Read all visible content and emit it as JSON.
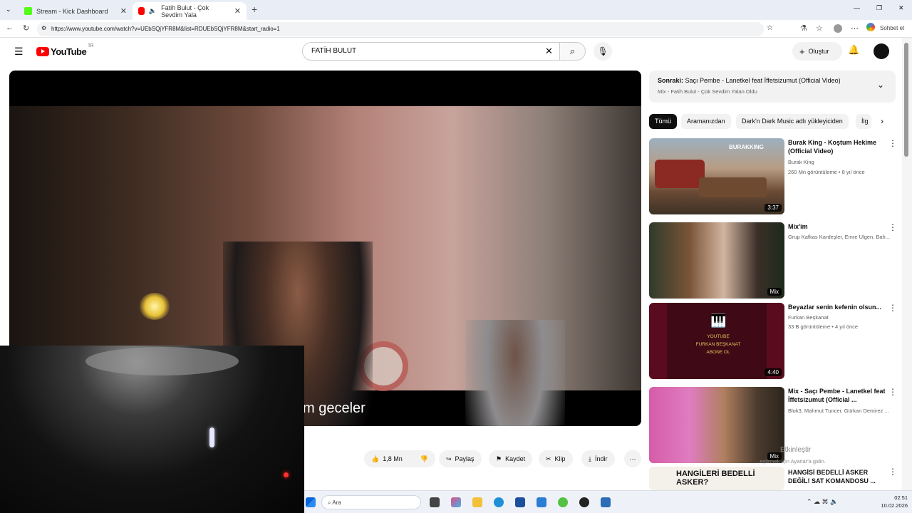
{
  "browser": {
    "tabs": [
      {
        "label": "Stream - Kick Dashboard",
        "active": false
      },
      {
        "label": "Fatih Bulut - Çok Sevdim Yala",
        "active": true
      }
    ],
    "new_tab": "+",
    "url": "https://www.youtube.com/watch?v=UEbSQjYFR8M&list=RDUEbSQjYFR8M&start_radio=1",
    "sohbet": "Sohbet et"
  },
  "youtube": {
    "logo": "YouTube",
    "region": "TR",
    "search_value": "FATİH BULUT",
    "create_label": "Oluştur"
  },
  "player": {
    "subtitle": "m geceler"
  },
  "actions": {
    "likes": "1,8 Mn",
    "share": "Paylaş",
    "save": "Kaydet",
    "clip": "Klip",
    "download": "İndir"
  },
  "mix": {
    "next_prefix": "Sonraki:",
    "next_title": "Saçı Pembe - Lanetkel feat İffetsizumut (Official Video)",
    "subtitle": "Mix - Fatih Bulut - Çok Sevdim Yalan Oldu"
  },
  "chips": [
    "Tümü",
    "Aramanızdan",
    "Dark'n Dark Music adlı yükleyiciden",
    "İlg"
  ],
  "recommendations": [
    {
      "title": "Burak King - Koştum Hekime (Official Video)",
      "channel": "Burak King",
      "meta": "260 Mn görüntüleme • 8 yıl önce",
      "badge": "3:37",
      "thumb_text": "BURAKKING"
    },
    {
      "title": "Mix'im",
      "channel": "Grup Kafkas Kardeşler, Emre Ulgen, Bah...",
      "meta": "",
      "badge": "Mix",
      "thumb_text": ""
    },
    {
      "title": "Beyazlar senin kefenin olsun...",
      "channel": "Furkan Beşkanat",
      "meta": "33 B görüntüleme • 4 yıl önce",
      "badge": "4:40",
      "thumb_text": "YOUTUBE\nFURKAN BEŞKANAT\nABONE OL"
    },
    {
      "title": "Mix - Saçı Pembe - Lanetkel feat İffetsizumut (Official ...",
      "channel": "Blok3, Mahmut Tuncer, Gürkan Demirez ...",
      "meta": "",
      "badge": "Mix",
      "thumb_text": ""
    },
    {
      "title": "HANGİSİ BEDELLİ ASKER DEĞİL! SAT KOMANDOSU ...",
      "channel": "",
      "meta": "",
      "badge": "",
      "thumb_text": "HANGİLERİ BEDELLİ ASKER?"
    }
  ],
  "watermark": {
    "line1": "Etkinleştir",
    "line2": "...eştirmek için Ayarlar'a gidin."
  },
  "taskbar": {
    "search": "Ara",
    "time": "02:51",
    "date": "10.02.2026"
  }
}
